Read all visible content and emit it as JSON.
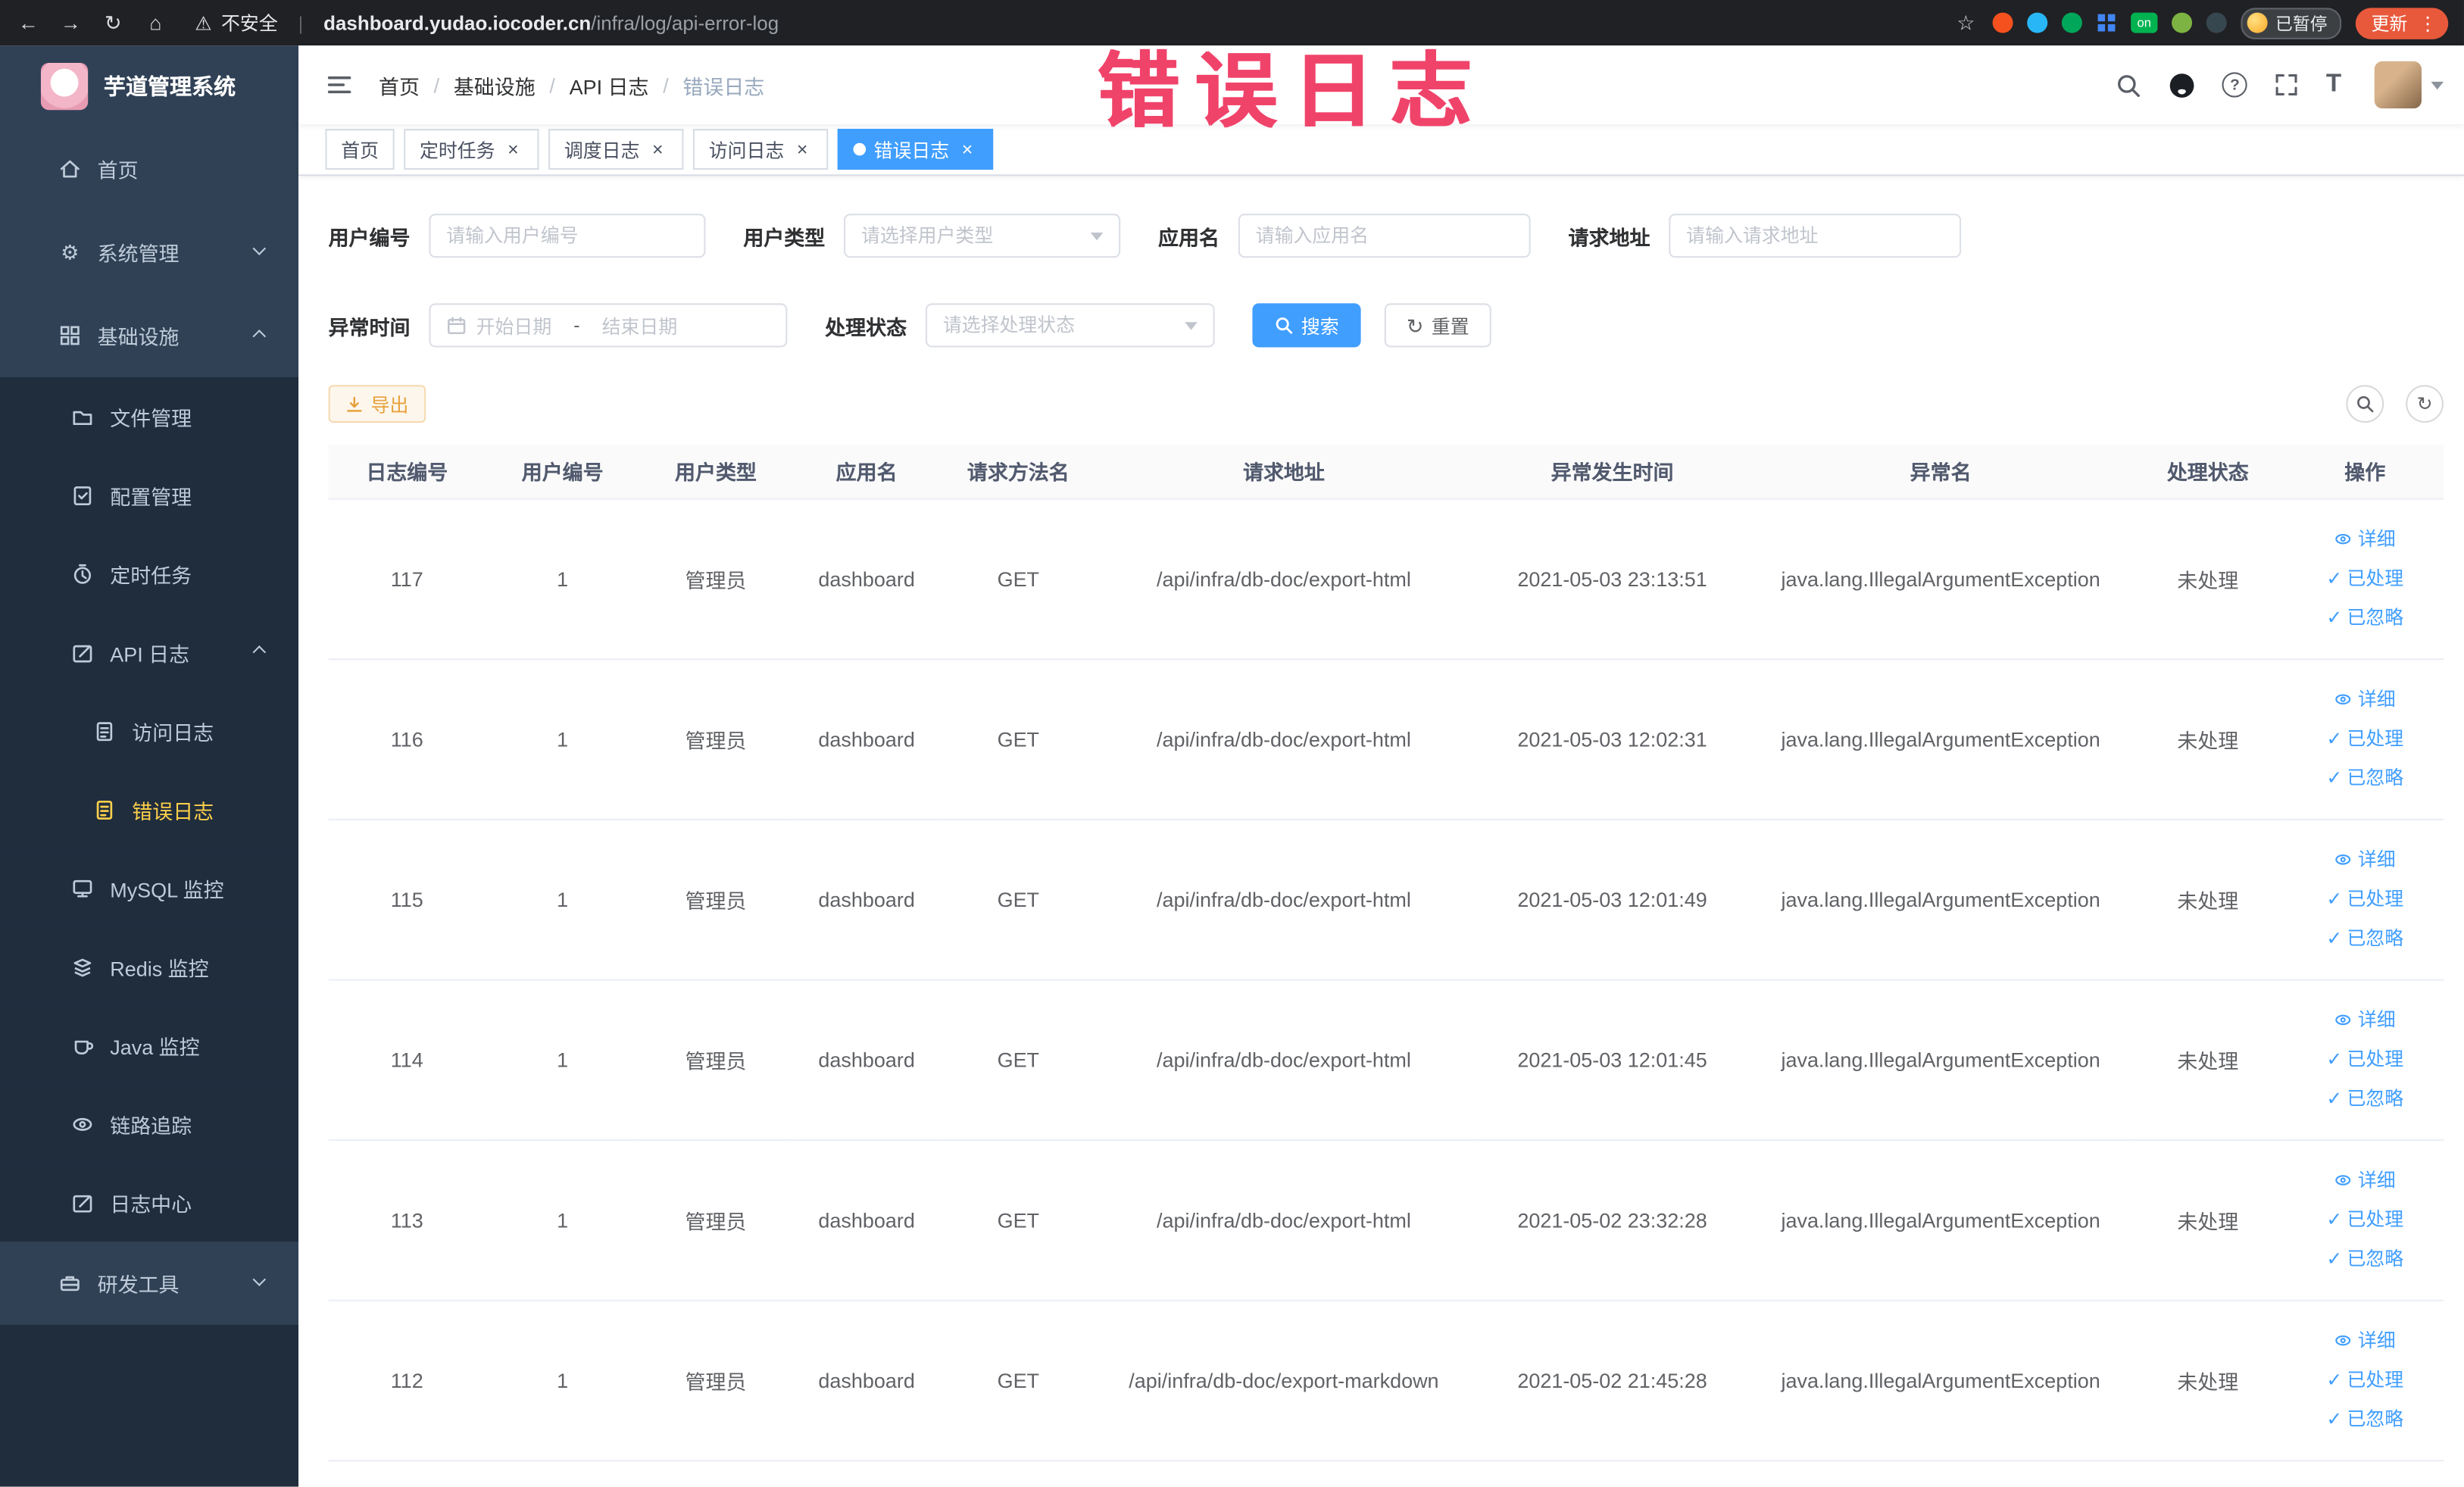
{
  "colors": {
    "accent_blue": "#409eff",
    "sidebar_bg": "#304156",
    "sidebar_sub_bg": "#1f2d3d",
    "sidebar_text": "#bfcbd9",
    "active_menu_yellow": "#ffd04b",
    "warning_orange": "#e6a23c",
    "annotation_pink": "#f0436a",
    "chrome_bg": "#202124"
  },
  "icons": {
    "back": "←",
    "forward": "→",
    "reload": "↻",
    "home": "⌂",
    "warning": "⚠",
    "star": "☆",
    "dots": "⋮",
    "gear": "⚙",
    "check": "✓",
    "refresh": "↻",
    "close": "×",
    "question": "?",
    "text_size": "T"
  },
  "browser": {
    "security_label": "不安全",
    "url_host": "dashboard.yudao.iocoder.cn",
    "url_path": "/infra/log/api-error-log",
    "extension_badge_on": "on",
    "paused_badge": "已暂停",
    "update_button": "更新"
  },
  "annotation": "错误日志",
  "sidebar": {
    "logo_title": "芋道管理系统",
    "items": [
      {
        "label": "首页"
      },
      {
        "label": "系统管理"
      },
      {
        "label": "基础设施"
      },
      {
        "label": "文件管理"
      },
      {
        "label": "配置管理"
      },
      {
        "label": "定时任务"
      },
      {
        "label": "API 日志"
      },
      {
        "label": "访问日志"
      },
      {
        "label": "错误日志"
      },
      {
        "label": "MySQL 监控"
      },
      {
        "label": "Redis 监控"
      },
      {
        "label": "Java 监控"
      },
      {
        "label": "链路追踪"
      },
      {
        "label": "日志中心"
      },
      {
        "label": "研发工具"
      }
    ]
  },
  "breadcrumb": {
    "separator": "/",
    "items": [
      "首页",
      "基础设施",
      "API 日志",
      "错误日志"
    ]
  },
  "tabs": [
    {
      "label": "首页"
    },
    {
      "label": "定时任务"
    },
    {
      "label": "调度日志"
    },
    {
      "label": "访问日志"
    },
    {
      "label": "错误日志"
    }
  ],
  "filters": {
    "user_id_label": "用户编号",
    "user_id_placeholder": "请输入用户编号",
    "user_type_label": "用户类型",
    "user_type_placeholder": "请选择用户类型",
    "app_name_label": "应用名",
    "app_name_placeholder": "请输入应用名",
    "request_url_label": "请求地址",
    "request_url_placeholder": "请输入请求地址",
    "exception_time_label": "异常时间",
    "date_start_placeholder": "开始日期",
    "date_separator": "-",
    "date_end_placeholder": "结束日期",
    "process_status_label": "处理状态",
    "process_status_placeholder": "请选择处理状态",
    "search_button": "搜索",
    "reset_button": "重置"
  },
  "toolbar": {
    "export_button": "导出"
  },
  "table": {
    "headers": [
      "日志编号",
      "用户编号",
      "用户类型",
      "应用名",
      "请求方法名",
      "请求地址",
      "异常发生时间",
      "异常名",
      "处理状态",
      "操作"
    ],
    "action_detail": "详细",
    "action_processed": "已处理",
    "action_ignored": "已忽略",
    "rows": [
      {
        "id": "117",
        "user_id": "1",
        "user_type": "管理员",
        "app": "dashboard",
        "method": "GET",
        "url": "/api/infra/db-doc/export-html",
        "time": "2021-05-03 23:13:51",
        "exception": "java.lang.IllegalArgumentException",
        "status": "未处理"
      },
      {
        "id": "116",
        "user_id": "1",
        "user_type": "管理员",
        "app": "dashboard",
        "method": "GET",
        "url": "/api/infra/db-doc/export-html",
        "time": "2021-05-03 12:02:31",
        "exception": "java.lang.IllegalArgumentException",
        "status": "未处理"
      },
      {
        "id": "115",
        "user_id": "1",
        "user_type": "管理员",
        "app": "dashboard",
        "method": "GET",
        "url": "/api/infra/db-doc/export-html",
        "time": "2021-05-03 12:01:49",
        "exception": "java.lang.IllegalArgumentException",
        "status": "未处理"
      },
      {
        "id": "114",
        "user_id": "1",
        "user_type": "管理员",
        "app": "dashboard",
        "method": "GET",
        "url": "/api/infra/db-doc/export-html",
        "time": "2021-05-03 12:01:45",
        "exception": "java.lang.IllegalArgumentException",
        "status": "未处理"
      },
      {
        "id": "113",
        "user_id": "1",
        "user_type": "管理员",
        "app": "dashboard",
        "method": "GET",
        "url": "/api/infra/db-doc/export-html",
        "time": "2021-05-02 23:32:28",
        "exception": "java.lang.IllegalArgumentException",
        "status": "未处理"
      },
      {
        "id": "112",
        "user_id": "1",
        "user_type": "管理员",
        "app": "dashboard",
        "method": "GET",
        "url": "/api/infra/db-doc/export-markdown",
        "time": "2021-05-02 21:45:28",
        "exception": "java.lang.IllegalArgumentException",
        "status": "未处理"
      }
    ]
  }
}
